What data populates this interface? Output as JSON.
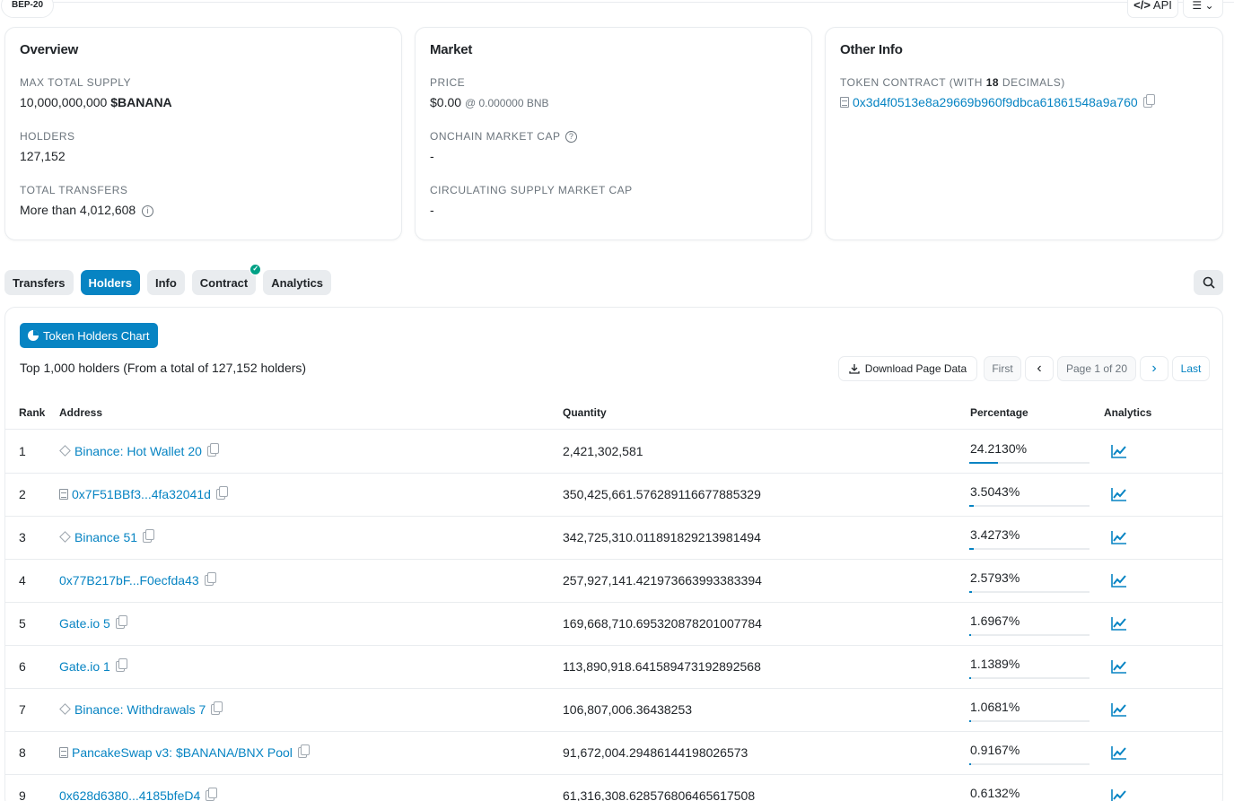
{
  "header": {
    "badge": "BEP-20",
    "api_label": "API",
    "api_icon": "code-icon",
    "menu_icon": "list-icon"
  },
  "overview": {
    "title": "Overview",
    "max_supply_label": "MAX TOTAL SUPPLY",
    "max_supply_value": "10,000,000,000",
    "max_supply_symbol": "$BANANA",
    "holders_label": "HOLDERS",
    "holders_value": "127,152",
    "transfers_label": "TOTAL TRANSFERS",
    "transfers_value": "More than 4,012,608"
  },
  "market": {
    "title": "Market",
    "price_label": "PRICE",
    "price_value": "$0.00",
    "price_bnb": "@ 0.000000 BNB",
    "mcap_label": "ONCHAIN MARKET CAP",
    "mcap_value": "-",
    "circ_label": "CIRCULATING SUPPLY MARKET CAP",
    "circ_value": "-"
  },
  "other_info": {
    "title": "Other Info",
    "contract_label_pre": "TOKEN CONTRACT (WITH ",
    "contract_decimals": "18",
    "contract_label_post": " DECIMALS)",
    "contract_address": "0x3d4f0513e8a29669b960f9dbca61861548a9a760"
  },
  "tabs": [
    {
      "label": "Transfers",
      "active": false
    },
    {
      "label": "Holders",
      "active": true
    },
    {
      "label": "Info",
      "active": false
    },
    {
      "label": "Contract",
      "active": false,
      "verified": true
    },
    {
      "label": "Analytics",
      "active": false
    }
  ],
  "holders": {
    "chart_button": "Token Holders Chart",
    "summary": "Top 1,000 holders (From a total of 127,152 holders)",
    "download_label": "Download Page Data",
    "pager": {
      "first": "First",
      "prev": "‹",
      "page": "Page 1 of 20",
      "next": "›",
      "last": "Last"
    },
    "columns": {
      "rank": "Rank",
      "address": "Address",
      "quantity": "Quantity",
      "percentage": "Percentage",
      "analytics": "Analytics"
    },
    "rows": [
      {
        "rank": "1",
        "address": "Binance: Hot Wallet 20",
        "icon": "diamond-icon",
        "quantity": "2,421,302,581",
        "percentage": "24.2130%",
        "pct_value": 24.213
      },
      {
        "rank": "2",
        "address": "0x7F51BBf3...4fa32041d",
        "icon": "contract-icon",
        "quantity": "350,425,661.576289116677885329",
        "percentage": "3.5043%",
        "pct_value": 3.5043
      },
      {
        "rank": "3",
        "address": "Binance 51",
        "icon": "diamond-icon",
        "quantity": "342,725,310.011891829213981494",
        "percentage": "3.4273%",
        "pct_value": 3.4273
      },
      {
        "rank": "4",
        "address": "0x77B217bF...F0ecfda43",
        "icon": "",
        "quantity": "257,927,141.421973663993383394",
        "percentage": "2.5793%",
        "pct_value": 2.5793
      },
      {
        "rank": "5",
        "address": "Gate.io 5",
        "icon": "",
        "quantity": "169,668,710.695320878201007784",
        "percentage": "1.6967%",
        "pct_value": 1.6967
      },
      {
        "rank": "6",
        "address": "Gate.io 1",
        "icon": "",
        "quantity": "113,890,918.641589473192892568",
        "percentage": "1.1389%",
        "pct_value": 1.1389
      },
      {
        "rank": "7",
        "address": "Binance: Withdrawals 7",
        "icon": "diamond-icon",
        "quantity": "106,807,006.36438253",
        "percentage": "1.0681%",
        "pct_value": 1.0681
      },
      {
        "rank": "8",
        "address": "PancakeSwap v3: $BANANA/BNX Pool",
        "icon": "contract-icon",
        "quantity": "91,672,004.29486144198026573",
        "percentage": "0.9167%",
        "pct_value": 0.9167
      },
      {
        "rank": "9",
        "address": "0x628d6380...4185bfeD4",
        "icon": "",
        "quantity": "61,316,308.628576806465617508",
        "percentage": "0.6132%",
        "pct_value": 0.6132
      }
    ]
  }
}
